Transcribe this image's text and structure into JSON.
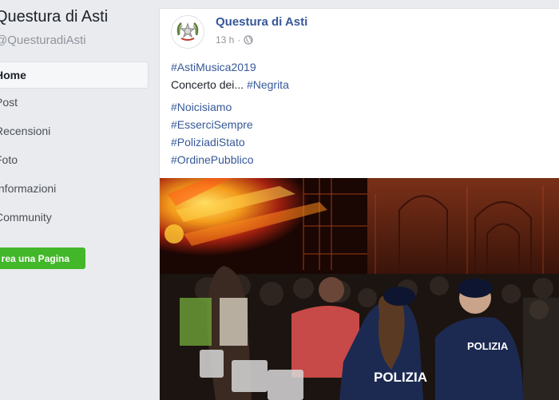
{
  "sidebar": {
    "page_name": "Questura di Asti",
    "handle": "@QuesturadiAsti",
    "nav": [
      {
        "label": "Home",
        "active": true
      },
      {
        "label": "Post",
        "active": false
      },
      {
        "label": "Recensioni",
        "active": false
      },
      {
        "label": "Foto",
        "active": false
      },
      {
        "label": "Informazioni",
        "active": false
      },
      {
        "label": "Community",
        "active": false
      }
    ],
    "create_page_label": "Crea una Pagina"
  },
  "post": {
    "author": "Questura di Asti",
    "time": "13 h",
    "audience_icon": "globe-icon",
    "hashtag_event": "#AstiMusica2019",
    "concert_text": "Concerto dei... ",
    "hashtag_band": "#Negrita",
    "hashtags": [
      "#Noicisiamo",
      "#EsserciSempre",
      "#PoliziadiStato",
      "#OrdinePubblico"
    ],
    "photo": {
      "uniform_label_left": "POLIZIA",
      "uniform_label_right": "POLIZIA"
    }
  },
  "colors": {
    "link": "#365899",
    "create_button": "#42b72a",
    "background": "#e9ebee"
  }
}
